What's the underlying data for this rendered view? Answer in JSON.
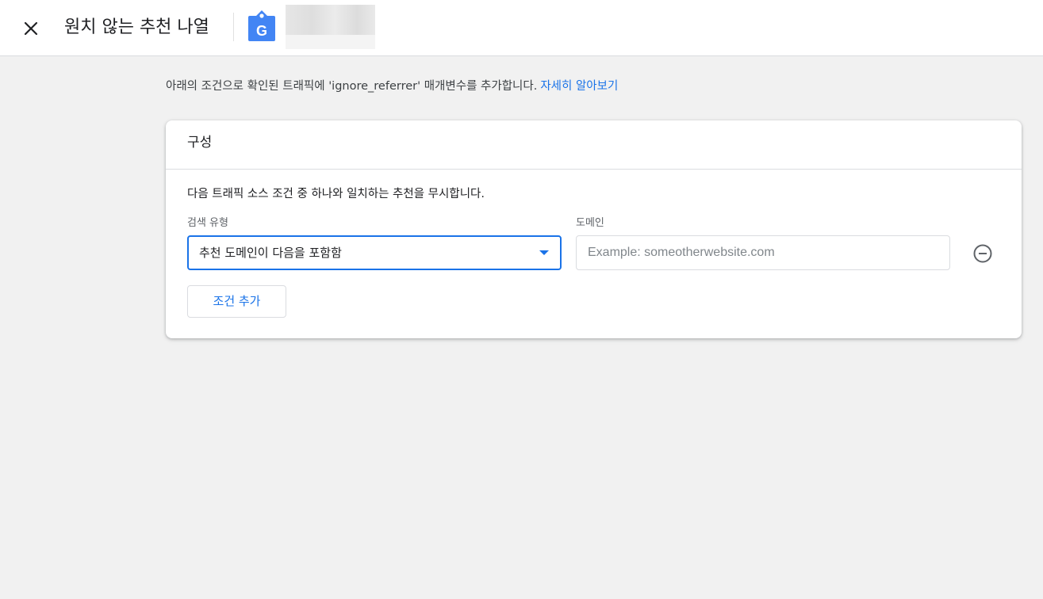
{
  "header": {
    "close_icon": "close-icon",
    "title": "원치 않는 추천 나열",
    "property_icon": "google-tag-icon",
    "accent": "#4285f4"
  },
  "intro": {
    "text": "아래의 조건으로 확인된 트래픽에 'ignore_referrer' 매개변수를 추가합니다.",
    "link": "자세히 알아보기"
  },
  "card": {
    "title": "구성",
    "description": "다음 트래픽 소스 조건 중 하나와 일치하는 추천을 무시합니다.",
    "match_type_label": "검색 유형",
    "match_type_value": "추천 도메인이 다음을 포함함",
    "domain_label": "도메인",
    "domain_value": "",
    "domain_placeholder": "Example: someotherwebsite.com",
    "remove_icon": "remove-circle-icon",
    "add_condition": "조건 추가"
  },
  "colors": {
    "link": "#1a73e8",
    "background": "#f1f1f1"
  }
}
